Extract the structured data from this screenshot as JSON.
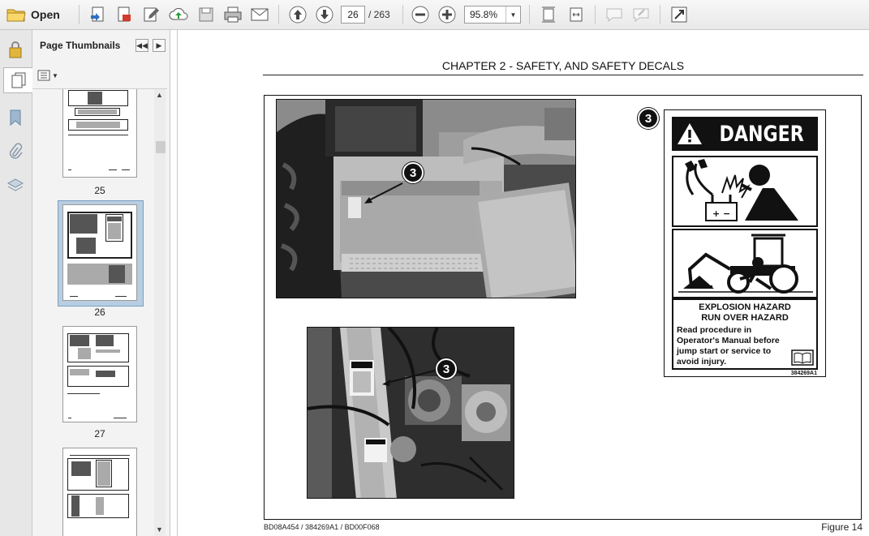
{
  "toolbar": {
    "open_label": "Open",
    "page_current": "26",
    "page_total": "/ 263",
    "zoom": "95.8%"
  },
  "sidebar": {
    "title": "Page Thumbnails",
    "thumbnails": [
      {
        "label": "25"
      },
      {
        "label": "26"
      },
      {
        "label": "27"
      }
    ]
  },
  "document": {
    "chapter_title": "CHAPTER 2 - SAFETY, AND SAFETY DECALS",
    "callout_number": "3",
    "decal": {
      "signal_word": "DANGER",
      "hazard_line1": "EXPLOSION HAZARD",
      "hazard_line2": "RUN OVER  HAZARD",
      "body": "Read procedure in Operator's Manual before jump start or service to avoid injury.",
      "code": "384269A1"
    },
    "footer_codes": "BD08A454 / 384269A1 / BD00F068",
    "figure_label": "Figure 14"
  }
}
